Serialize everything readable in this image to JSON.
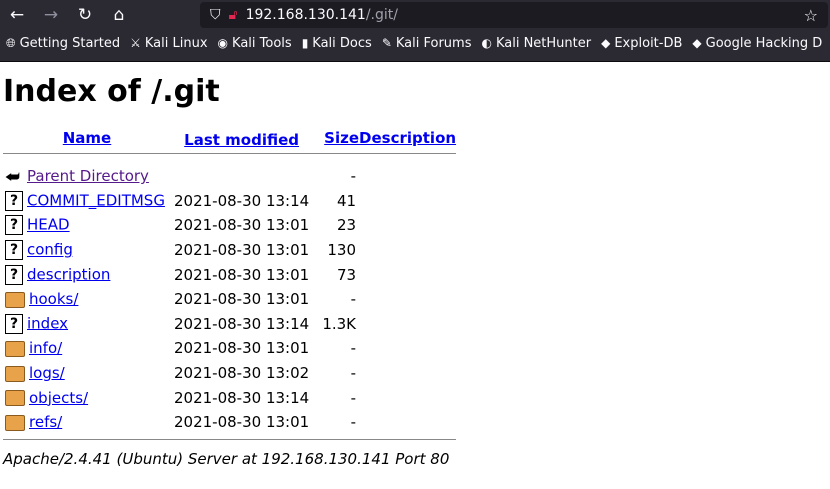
{
  "browser": {
    "url_host": "192.168.130.141",
    "url_path": "/.git/",
    "bookmarks": [
      "Getting Started",
      "Kali Linux",
      "Kali Tools",
      "Kali Docs",
      "Kali Forums",
      "Kali NetHunter",
      "Exploit-DB",
      "Google Hacking D"
    ]
  },
  "page": {
    "title": "Index of /.git",
    "headers": {
      "name": "Name",
      "modified": "Last modified",
      "size": "Size",
      "description": "Description"
    },
    "rows": [
      {
        "icon": "back",
        "name": "Parent Directory",
        "modified": "",
        "size": "-"
      },
      {
        "icon": "file",
        "name": "COMMIT_EDITMSG",
        "modified": "2021-08-30 13:14",
        "size": "41"
      },
      {
        "icon": "file",
        "name": "HEAD",
        "modified": "2021-08-30 13:01",
        "size": "23"
      },
      {
        "icon": "file",
        "name": "config",
        "modified": "2021-08-30 13:01",
        "size": "130"
      },
      {
        "icon": "file",
        "name": "description",
        "modified": "2021-08-30 13:01",
        "size": "73"
      },
      {
        "icon": "folder",
        "name": "hooks/",
        "modified": "2021-08-30 13:01",
        "size": "-"
      },
      {
        "icon": "file",
        "name": "index",
        "modified": "2021-08-30 13:14",
        "size": "1.3K"
      },
      {
        "icon": "folder",
        "name": "info/",
        "modified": "2021-08-30 13:01",
        "size": "-"
      },
      {
        "icon": "folder",
        "name": "logs/",
        "modified": "2021-08-30 13:02",
        "size": "-"
      },
      {
        "icon": "folder",
        "name": "objects/",
        "modified": "2021-08-30 13:14",
        "size": "-"
      },
      {
        "icon": "folder",
        "name": "refs/",
        "modified": "2021-08-30 13:01",
        "size": "-"
      }
    ],
    "footer": "Apache/2.4.41 (Ubuntu) Server at 192.168.130.141 Port 80"
  }
}
